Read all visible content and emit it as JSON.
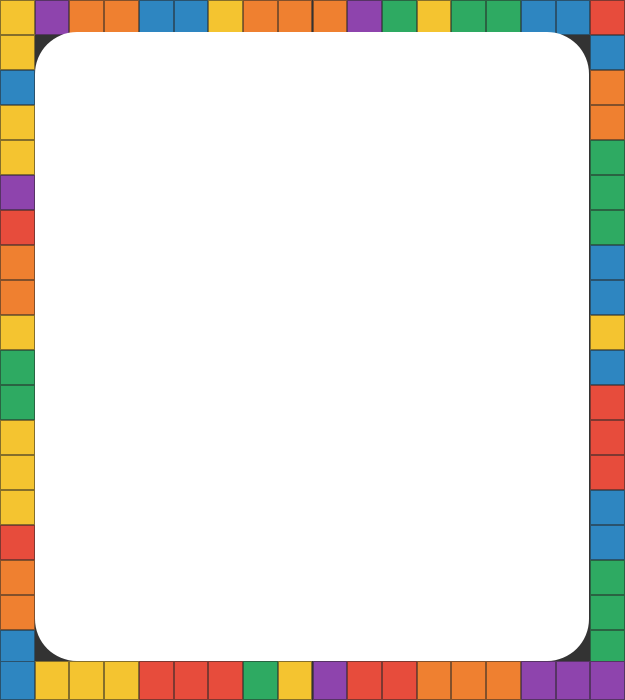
{
  "palette": {
    "yellow": "#f4c430",
    "purple": "#8e44ad",
    "orange": "#ef8030",
    "blue": "#2e86c1",
    "green": "#2eaa62",
    "red": "#e74c3c"
  },
  "panel": {
    "background": "#ffffff"
  },
  "border": {
    "top": [
      "yellow",
      "purple",
      "orange",
      "orange",
      "blue",
      "blue",
      "yellow",
      "orange",
      "orange",
      "orange",
      "purple",
      "green",
      "yellow",
      "green",
      "green",
      "blue",
      "blue",
      "red"
    ],
    "bottom": [
      "blue",
      "yellow",
      "yellow",
      "yellow",
      "red",
      "red",
      "red",
      "green",
      "yellow",
      "purple",
      "red",
      "red",
      "orange",
      "orange",
      "orange",
      "purple",
      "purple",
      "purple"
    ],
    "left": [
      "yellow",
      "blue",
      "yellow",
      "yellow",
      "purple",
      "red",
      "orange",
      "orange",
      "yellow",
      "green",
      "green",
      "yellow",
      "yellow",
      "yellow",
      "red",
      "orange",
      "orange",
      "blue"
    ],
    "right": [
      "blue",
      "orange",
      "orange",
      "green",
      "green",
      "green",
      "blue",
      "blue",
      "yellow",
      "blue",
      "red",
      "red",
      "red",
      "blue",
      "blue",
      "green",
      "green",
      "green"
    ]
  }
}
